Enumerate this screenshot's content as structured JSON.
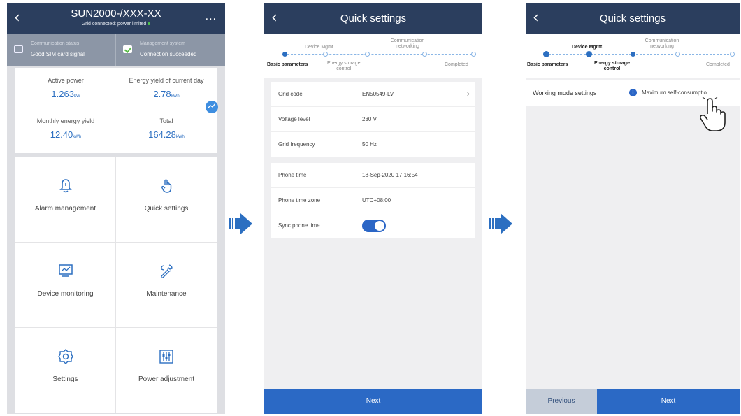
{
  "phone1": {
    "title": "SUN2000-/XXX-XX",
    "subtitle": "Grid connected: power limited",
    "status": [
      {
        "label": "Communication status",
        "value": "Good SIM card signal",
        "icon": "sim-signal-icon"
      },
      {
        "label": "Management system",
        "value": "Connection succeeded",
        "icon": "check-icon"
      }
    ],
    "metrics": {
      "active_power": {
        "label": "Active power",
        "value": "1.263",
        "unit": "kW"
      },
      "energy_today": {
        "label": "Energy yield of current day",
        "value": "2.78",
        "unit": "kWh"
      },
      "monthly": {
        "label": "Monthly energy yield",
        "value": "12.40",
        "unit": "kWh"
      },
      "total": {
        "label": "Total",
        "value": "164.28",
        "unit": "kWh"
      }
    },
    "tiles": [
      {
        "label": "Alarm management",
        "icon": "bell-icon"
      },
      {
        "label": "Quick settings",
        "icon": "tap-hand-icon"
      },
      {
        "label": "Device monitoring",
        "icon": "monitor-icon"
      },
      {
        "label": "Maintenance",
        "icon": "wrench-icon"
      },
      {
        "label": "Settings",
        "icon": "gear-icon"
      },
      {
        "label": "Power adjustment",
        "icon": "sliders-icon"
      }
    ],
    "menu": "..."
  },
  "phone2": {
    "title": "Quick settings",
    "steps": {
      "device_mgmt": "Device Mgmt.",
      "communication": [
        "Communication",
        "networking"
      ],
      "basic": "Basic parameters",
      "energy": [
        "Energy storage",
        "control"
      ],
      "completed": "Completed"
    },
    "grid_card": [
      {
        "label": "Grid code",
        "value": "EN50549-LV"
      },
      {
        "label": "Voltage level",
        "value": "230 V"
      },
      {
        "label": "Grid frequency",
        "value": "50 Hz"
      }
    ],
    "time_card": [
      {
        "label": "Phone time",
        "value": "18-Sep-2020 17:16:54"
      },
      {
        "label": "Phone time zone",
        "value": "UTC+08:00"
      },
      {
        "label": "Sync phone time",
        "toggle_on": true
      }
    ],
    "next_label": "Next"
  },
  "phone3": {
    "title": "Quick settings",
    "steps": {
      "device_mgmt": "Device Mgmt.",
      "communication": [
        "Communication",
        "networking"
      ],
      "basic": "Basic parameters",
      "energy": [
        "Energy storage",
        "control"
      ],
      "completed": "Completed"
    },
    "working_mode_label": "Working mode settings",
    "working_mode_value": "Maximum self-consumptio",
    "info_glyph": "i",
    "previous_label": "Previous",
    "next_label": "Next"
  },
  "colors": {
    "header": "#2b3e5e",
    "accent": "#2b69c5",
    "arrow": "#2c6fc1",
    "value_blue": "#2c6fc1"
  }
}
